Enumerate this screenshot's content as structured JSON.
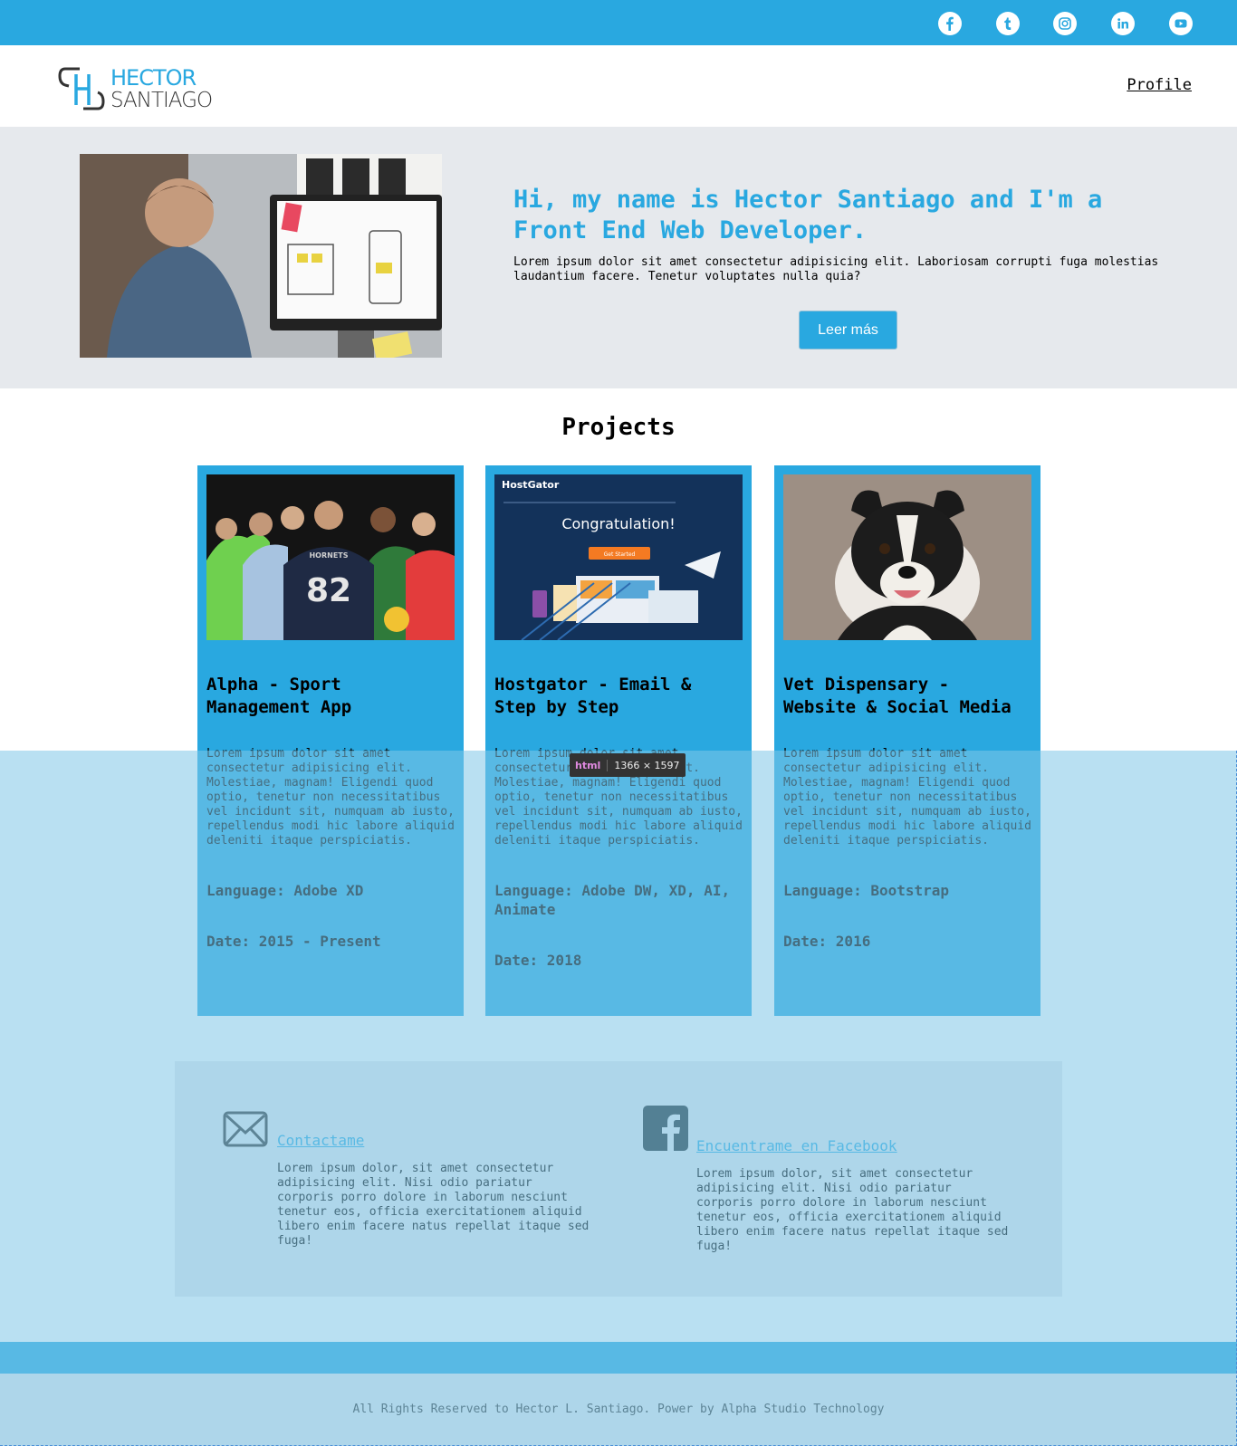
{
  "social": [
    "facebook-icon",
    "tumblr-icon",
    "instagram-icon",
    "linkedin-icon",
    "youtube-icon"
  ],
  "logo": {
    "line1": "HECTOR",
    "line2": "SANTIAGO"
  },
  "nav": {
    "profile": "Profile"
  },
  "hero": {
    "title": "Hi, my name is Hector Santiago and I'm a Front End Web Developer.",
    "text": "Lorem ipsum dolor sit amet consectetur adipisicing elit. Laboriosam corrupti fuga molestias laudantium facere. Tenetur voluptates nulla quia?",
    "button": "Leer más"
  },
  "projects": {
    "heading": "Projects",
    "items": [
      {
        "title": "Alpha - Sport Management App",
        "description": "Lorem ipsum dolor sit amet consectetur adipisicing elit. Molestiae, magnam! Eligendi quod optio, tenetur non necessitatibus vel incidunt sit, numquam ab iusto, repellendus modi hic labore aliquid deleniti itaque perspiciatis.",
        "language": "Language: Adobe XD",
        "date": "Date: 2015 - Present"
      },
      {
        "title": "Hostgator - Email & Step by Step",
        "description": "Lorem ipsum dolor sit amet consectetur adipisicing elit. Molestiae, magnam! Eligendi quod optio, tenetur non necessitatibus vel incidunt sit, numquam ab iusto, repellendus modi hic labore aliquid deleniti itaque perspiciatis.",
        "language": "Language: Adobe DW, XD, AI, Animate",
        "date": "Date: 2018",
        "image_brand": "HostGator",
        "image_headline": "Congratulation!",
        "image_button": "Get Started"
      },
      {
        "title": "Vet Dispensary - Website & Social Media",
        "description": "Lorem ipsum dolor sit amet consectetur adipisicing elit. Molestiae, magnam! Eligendi quod optio, tenetur non necessitatibus vel incidunt sit, numquam ab iusto, repellendus modi hic labore aliquid deleniti itaque perspiciatis.",
        "language": "Language: Bootstrap",
        "date": "Date: 2016"
      }
    ]
  },
  "contact": {
    "email_link": "Contactame",
    "email_text": "Lorem ipsum dolor, sit amet consectetur adipisicing elit. Nisi odio pariatur corporis porro dolore in laborum nesciunt tenetur eos, officia exercitationem aliquid libero enim facere natus repellat itaque sed fuga!",
    "facebook_link": "Encuentrame en Facebook",
    "facebook_text": "Lorem ipsum dolor, sit amet consectetur adipisicing elit. Nisi odio pariatur corporis porro dolore in laborum nesciunt tenetur eos, officia exercitationem aliquid libero enim facere natus repellat itaque sed fuga!"
  },
  "footer": {
    "text": "All Rights Reserved to Hector L. Santiago. Power by Alpha Studio Technology"
  },
  "devtools": {
    "tag": "html",
    "size": "1366 × 1597"
  },
  "colors": {
    "brand": "#29a8e0",
    "hero_bg": "#e6e9ed",
    "overlay": "#80c6e8"
  }
}
